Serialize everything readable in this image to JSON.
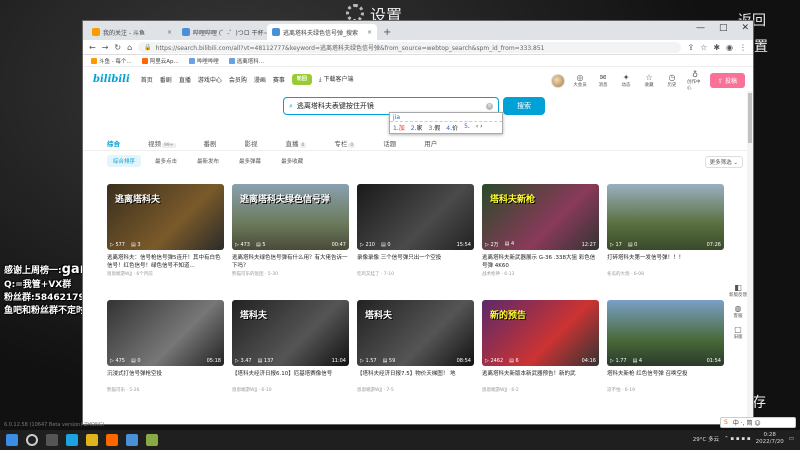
{
  "overlay": {
    "settings": "设置",
    "back": "返回",
    "place": "置",
    "save": "保存",
    "fans_line1": "感谢上周榜一:",
    "fans_line1b": "gan",
    "fans_line2": "Q:",
    "fans_line2b": "=我管+VX群",
    "fans_line3": "粉丝群:",
    "fans_line3b": "58462179€",
    "fans_line4": "鱼吧和粉丝群不定时会有抽奖视频和天赋"
  },
  "window": {
    "tabs": [
      {
        "label": "我的关注 - 斗鱼"
      },
      {
        "label": "哔哩哔哩 (゜-゜)つロ 干杯~"
      },
      {
        "label": "逃离塔科夫绿色信号弹_搜索",
        "active": true
      }
    ],
    "new_tab": "+",
    "min": "—",
    "max": "□",
    "close": "✕"
  },
  "address": {
    "url": "https://search.bilibili.com/all?vt=48112777&keyword=逃离塔科夫绿色信号弹&from_source=webtop_search&spm_id_from=333.851",
    "lock": "🔒"
  },
  "bookmarks": [
    {
      "label": "斗鱼 - 每个..."
    },
    {
      "label": "阿里云Ap..."
    },
    {
      "label": "哔哩哔哩"
    },
    {
      "label": "逃离塔科..."
    }
  ],
  "bili": {
    "logo": "bilibili",
    "nav": [
      "首页",
      "番剧",
      "直播",
      "游戏中心",
      "会员购",
      "漫画",
      "赛事"
    ],
    "promo": "轮回",
    "download": "下载客户端",
    "right": [
      {
        "icon": "◎",
        "label": "大会员"
      },
      {
        "icon": "✉",
        "label": "消息"
      },
      {
        "icon": "✦",
        "label": "动态"
      },
      {
        "icon": "☆",
        "label": "收藏"
      },
      {
        "icon": "◷",
        "label": "历史"
      },
      {
        "icon": "♁",
        "label": "创作中心"
      }
    ],
    "upload": "投稿"
  },
  "search": {
    "value": "逃离塔科夫表键按住开镜",
    "button": "搜索",
    "icon": "search-icon"
  },
  "ime": {
    "composition": "jia",
    "candidates": [
      {
        "n": "1",
        "t": "加"
      },
      {
        "n": "2",
        "t": "家"
      },
      {
        "n": "3",
        "t": "假"
      },
      {
        "n": "4",
        "t": "价"
      },
      {
        "n": "5",
        "t": ""
      }
    ],
    "nav": "‹ ›"
  },
  "subtabs": [
    {
      "label": "综合",
      "on": true
    },
    {
      "label": "视频",
      "count": "99+"
    },
    {
      "label": "番剧",
      "count": ""
    },
    {
      "label": "影视",
      "count": ""
    },
    {
      "label": "直播",
      "count": "0"
    },
    {
      "label": "专栏",
      "count": "0"
    },
    {
      "label": "话题",
      "count": ""
    },
    {
      "label": "用户",
      "count": ""
    }
  ],
  "filters": {
    "chips": [
      "综合排序",
      "最多点击",
      "最新发布",
      "最多弹幕",
      "最多收藏"
    ],
    "more": "更多筛选 ⌄"
  },
  "videos": [
    {
      "title": "逃离塔科夫：信号枪信号弹5连开！其中有白色信号！红色信号！绿色信号不知道...",
      "meta": "恩恩端游WJJ · 6个月前",
      "views": "577",
      "dm": "3",
      "dur": "",
      "cap": "逃离塔科夫"
    },
    {
      "title": "逃离塔科夫绿色信号弹有什么用？有大佬告诉一下吗？",
      "meta": "熊猫可乐的饭团 · 5-30",
      "views": "473",
      "dm": "5",
      "dur": "00:47",
      "cap": "逃离塔科夫绿色信号弹"
    },
    {
      "title": "录像录像 三个信号弹只出一个空投",
      "meta": "吃鸡又挂了 · 7-10",
      "views": "210",
      "dm": "0",
      "dur": "15:54",
      "cap": ""
    },
    {
      "title": "逃离塔科夫新武器展示 G-36 .338大狙 彩色信号弹 4K60",
      "meta": "战术枪神 · 6-13",
      "views": "2万",
      "dm": "4",
      "dur": "12:27",
      "cap": "塔科夫新枪"
    },
    {
      "title": "打碎塔科夫第一发信号弹！！！",
      "meta": "冬瓜的大炮 · 6-08",
      "views": "17",
      "dm": "0",
      "dur": "07:26",
      "cap": ""
    },
    {
      "title": "沉浸式打信号弹枪空投",
      "meta": "熊猫可乐 · 5-26",
      "views": "475",
      "dm": "0",
      "dur": "05:18",
      "cap": ""
    },
    {
      "title": "【塔科夫经济日报6.10】厄基塔赛像信号",
      "meta": "恩恩端游WJJ · 6-10",
      "views": "3.47",
      "dm": "137",
      "dur": "11:04",
      "cap": "塔科夫"
    },
    {
      "title": "【塔科夫经济日报7.5】物价天梯图！ 地",
      "meta": "恩恩端游WJJ · 7-5",
      "views": "1.57",
      "dm": "59",
      "dur": "08:54",
      "cap": "塔科夫"
    },
    {
      "title": "逃离塔科夫新版本新武器预告！新的武",
      "meta": "恩恩端游WJJ · 6-2",
      "views": "2462",
      "dm": "6",
      "dur": "04:16",
      "cap": "新的预告"
    },
    {
      "title": "塔科夫新枪 红色信号弹 召唤空投",
      "meta": "凉不怕 · 6-19",
      "views": "1.77",
      "dm": "4",
      "dur": "01:54",
      "cap": ""
    }
  ],
  "sidebuttons": [
    {
      "icon": "◧",
      "label": "新版反馈"
    },
    {
      "icon": "◍",
      "label": "客服"
    },
    {
      "icon": "▢",
      "label": "旧版"
    }
  ],
  "taskbar": {
    "weather": "29°C 多云",
    "time": "0:28",
    "date": "2022/7/20",
    "ime": "中 ·, 简 ☺"
  },
  "watermark": "6.0.12.58 (10647 Beta version) ZHONGl"
}
